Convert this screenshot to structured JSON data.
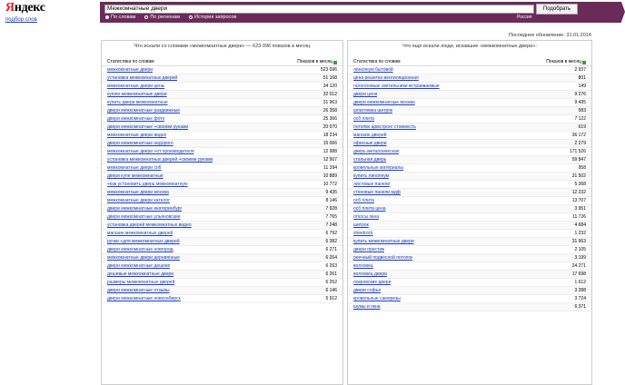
{
  "header": {
    "logo_red": "Я",
    "logo_rest": "ндекс",
    "word_selection_link": "подбор слов",
    "search_value": "Межкомнатные двери",
    "region": "Россия",
    "submit_label": "Подобрать",
    "radios": [
      {
        "label": "По словам",
        "selected": true
      },
      {
        "label": "По регионам",
        "selected": false
      },
      {
        "label": "История запросов",
        "selected": false
      }
    ],
    "last_update": "Последнее обновление: 31.01.2014"
  },
  "left": {
    "title": "Что искали со словами «межкомнатные двери» — 623 096 показов в месяц",
    "col1": "Статистика по словам",
    "col2": "Показов в месяц",
    "rows": [
      {
        "phrase": "межкомнатные двери",
        "count": "523 096"
      },
      {
        "phrase": "установка межкомнатных дверей",
        "count": "51 168"
      },
      {
        "phrase": "межкомнатные двери цены",
        "count": "34 120"
      },
      {
        "phrase": "куплю межкомнатные двери",
        "count": "32 012"
      },
      {
        "phrase": "купить двери межкомнатные",
        "count": "31 963"
      },
      {
        "phrase": "двери межкомнатные раздвижные",
        "count": "26 358"
      },
      {
        "phrase": "двери межкомнатные фото",
        "count": "25 366"
      },
      {
        "phrase": "двери межкомнатные +своими руками",
        "count": "20 070"
      },
      {
        "phrase": "межкомнатные двери видео",
        "count": "18 234"
      },
      {
        "phrase": "двери межкомнатные недорого",
        "count": "15 066"
      },
      {
        "phrase": "межкомнатные двери +от производителя",
        "count": "12 988"
      },
      {
        "phrase": "установка межкомнатных дверей +своими руками",
        "count": "12 507"
      },
      {
        "phrase": "межкомнатные двери спб",
        "count": "11 394"
      },
      {
        "phrase": "двери купе межкомнатные",
        "count": "10 889"
      },
      {
        "phrase": "+как установить дверь межкомнатную",
        "count": "10 772"
      },
      {
        "phrase": "межкомнатные двери москва",
        "count": "9 435"
      },
      {
        "phrase": "межкомнатные двери каталог",
        "count": "8 146"
      },
      {
        "phrase": "двери межкомнатные екатеринбург",
        "count": "7 928"
      },
      {
        "phrase": "двери межкомнатные ульяновские",
        "count": "7 765"
      },
      {
        "phrase": "установка дверей межкомнатных видео",
        "count": "7 248"
      },
      {
        "phrase": "магазин межкомнатных дверей",
        "count": "6 792"
      },
      {
        "phrase": "ручки +для межкомнатных дверей",
        "count": "6 382"
      },
      {
        "phrase": "двери межкомнатные новгород",
        "count": "6 271"
      },
      {
        "phrase": "межкомнатные двери деревянные",
        "count": "6 264"
      },
      {
        "phrase": "двери межкомнатные дешево",
        "count": "6 263"
      },
      {
        "phrase": "дешевые межкомнатные двери",
        "count": "6 261"
      },
      {
        "phrase": "размеры межкомнатных дверей",
        "count": "6 252"
      },
      {
        "phrase": "двери межкомнатные отзывы",
        "count": "6 146"
      },
      {
        "phrase": "двери межкомнатные новосибирск",
        "count": "5 912"
      }
    ]
  },
  "right": {
    "title": "Что еще искали люди, искавшие «межкомнатные двери»:",
    "col1": "Статистика по словам",
    "col2": "Показов в месяц",
    "rows": [
      {
        "phrase": "линолеум бытовой",
        "count": "2 937"
      },
      {
        "phrase": "цена решетка вентиляционная",
        "count": "801"
      },
      {
        "phrase": "галогеновые светильники встраиваемые",
        "count": "149"
      },
      {
        "phrase": "двери цена",
        "count": "9 276"
      },
      {
        "phrase": "двери межкомнатные москва",
        "count": "9 435"
      },
      {
        "phrase": "шпатлевка шитрок",
        "count": "583"
      },
      {
        "phrase": "осб плита",
        "count": "7 122"
      },
      {
        "phrase": "потолки армстронг стоимость",
        "count": "619"
      },
      {
        "phrase": "магазин дверей",
        "count": "36 172"
      },
      {
        "phrase": "офисные двери",
        "count": "2 279"
      },
      {
        "phrase": "дверь металлическая",
        "count": "171 526"
      },
      {
        "phrase": "стальная дверь",
        "count": "59 847"
      },
      {
        "phrase": "кровельные материалы",
        "count": "958"
      },
      {
        "phrase": "купить линолеум",
        "count": "31 502"
      },
      {
        "phrase": "листовые панели",
        "count": "5 368"
      },
      {
        "phrase": "стеновые панели мдф",
        "count": "12 232"
      },
      {
        "phrase": "осб плита",
        "count": "13 707"
      },
      {
        "phrase": "осб плита цена",
        "count": "3 951"
      },
      {
        "phrase": "откосы окна",
        "count": "11 726"
      },
      {
        "phrase": "шитрок",
        "count": "4 684"
      },
      {
        "phrase": "sheetrock",
        "count": "1 232"
      },
      {
        "phrase": "купить межкомнатные двери",
        "count": "31 963"
      },
      {
        "phrase": "двери престиж",
        "count": "2 105"
      },
      {
        "phrase": "реечный подвесной потолок",
        "count": "3 199"
      },
      {
        "phrase": "волховец",
        "count": "24 271"
      },
      {
        "phrase": "волховец двери",
        "count": "17 698"
      },
      {
        "phrase": "покровские двери",
        "count": "1 612"
      },
      {
        "phrase": "двери софья",
        "count": "3 288"
      },
      {
        "phrase": "кровельные саморезы",
        "count": "3 724"
      },
      {
        "phrase": "шумы и окна",
        "count": "6 371"
      }
    ]
  }
}
